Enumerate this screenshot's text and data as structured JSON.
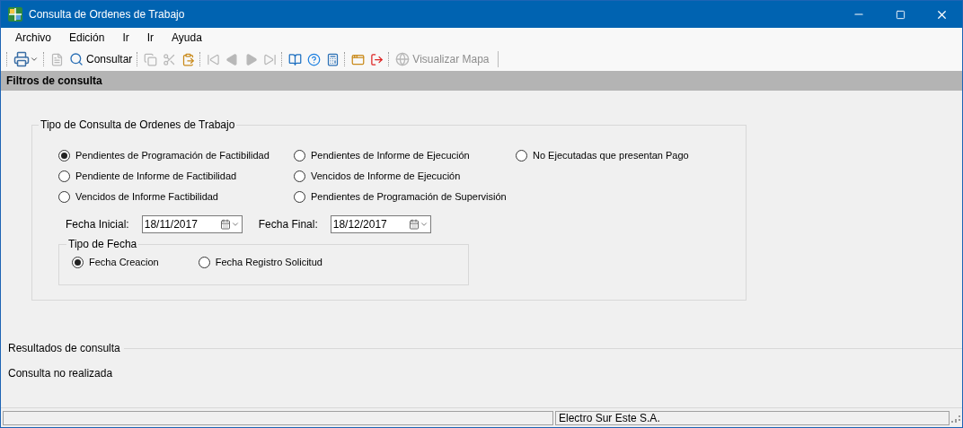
{
  "window": {
    "title": "Consulta de Ordenes de Trabajo"
  },
  "menu": [
    "Archivo",
    "Edición",
    "Ir",
    "Ir",
    "Ayuda"
  ],
  "toolbar": [
    [
      {
        "kind": "print",
        "disabled": false
      }
    ],
    [
      {
        "kind": "report",
        "disabled": true
      },
      {
        "kind": "search",
        "label": "Consultar",
        "disabled": false
      }
    ],
    [
      {
        "kind": "copy",
        "disabled": true
      },
      {
        "kind": "cut",
        "disabled": true
      },
      {
        "kind": "paste",
        "disabled": false
      }
    ],
    [
      {
        "kind": "first",
        "disabled": true
      },
      {
        "kind": "prev",
        "disabled": true
      },
      {
        "kind": "next",
        "disabled": true
      },
      {
        "kind": "last",
        "disabled": true
      }
    ],
    [
      {
        "kind": "book",
        "disabled": false
      },
      {
        "kind": "help",
        "disabled": false
      },
      {
        "kind": "calculator",
        "disabled": false
      }
    ],
    [
      {
        "kind": "windows",
        "disabled": false
      },
      {
        "kind": "exit",
        "disabled": false
      }
    ],
    [
      {
        "kind": "globe",
        "label": "Visualizar Mapa",
        "disabled": true
      }
    ]
  ],
  "filter_header": "Filtros de consulta",
  "query_group": {
    "title": "Tipo de Consulta de Ordenes de Trabajo",
    "options": [
      [
        {
          "label": "Pendientes de Programación de Factibilidad",
          "selected": true
        },
        {
          "label": "Pendiente de Informe de Factibilidad",
          "selected": false
        },
        {
          "label": "Vencidos de Informe Factibilidad",
          "selected": false
        }
      ],
      [
        {
          "label": "Pendientes de Informe de Ejecución",
          "selected": false
        },
        {
          "label": "Vencidos de Informe de Ejecución",
          "selected": false
        },
        {
          "label": "Pendientes de Programación de Supervisión",
          "selected": false
        }
      ],
      [
        {
          "label": "No Ejecutadas que presentan Pago",
          "selected": false
        }
      ]
    ],
    "start_date": {
      "label": "Fecha Inicial:",
      "value": "18/11/2017"
    },
    "end_date": {
      "label": "Fecha Final:",
      "value": "18/12/2017"
    },
    "date_type": {
      "title": "Tipo de Fecha",
      "options": [
        {
          "label": "Fecha Creacion",
          "selected": true
        },
        {
          "label": "Fecha Registro Solicitud",
          "selected": false
        }
      ]
    }
  },
  "results": {
    "title": "Resultados de consulta",
    "message": "Consulta no realizada"
  },
  "status_bar": {
    "company": "Electro Sur Este S.A."
  }
}
